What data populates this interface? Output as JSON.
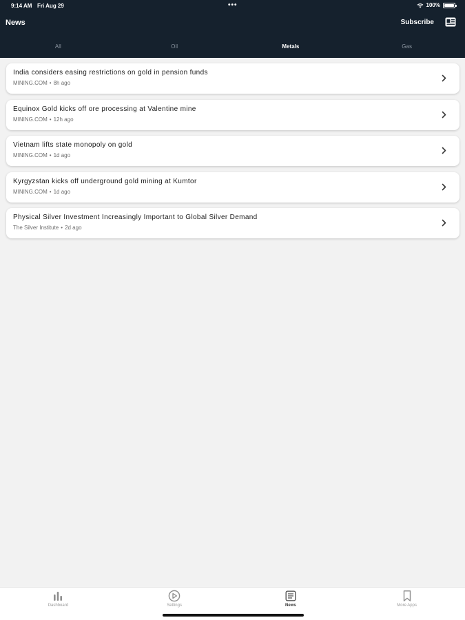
{
  "status_bar": {
    "time": "9:14 AM",
    "date": "Fri Aug 29",
    "dots": "•••",
    "battery": "100%"
  },
  "nav": {
    "title": "News",
    "subscribe_label": "Subscribe",
    "reader_icon": "reader-mode-icon"
  },
  "tabs": [
    {
      "label": "All",
      "active": false
    },
    {
      "label": "Oil",
      "active": false
    },
    {
      "label": "Metals",
      "active": true
    },
    {
      "label": "Gas",
      "active": false
    }
  ],
  "news": [
    {
      "title": "India considers easing restrictions on gold in pension funds",
      "source": "MINING.COM",
      "age": "8h ago"
    },
    {
      "title": "Equinox Gold kicks off ore processing at Valentine mine",
      "source": "MINING.COM",
      "age": "12h ago"
    },
    {
      "title": "Vietnam lifts state monopoly on gold",
      "source": "MINING.COM",
      "age": "1d ago"
    },
    {
      "title": "Kyrgyzstan kicks off underground gold mining at Kumtor",
      "source": "MINING.COM",
      "age": "1d ago"
    },
    {
      "title": "Physical Silver Investment Increasingly Important to Global Silver Demand",
      "source": "The Silver Institute",
      "age": "2d ago"
    }
  ],
  "meta_separator": "•",
  "tabbar": [
    {
      "label": "Dashboard",
      "icon": "bar-chart-icon",
      "active": false
    },
    {
      "label": "Settings",
      "icon": "play-circle-icon",
      "active": false
    },
    {
      "label": "News",
      "icon": "newspaper-icon",
      "active": true
    },
    {
      "label": "More Apps",
      "icon": "bookmark-icon",
      "active": false
    }
  ],
  "colors": {
    "header_bg": "#15212d",
    "page_bg": "#f2f2f2",
    "card_bg": "#ffffff",
    "tab_inactive": "#8b95a0",
    "tab_active": "#ffffff"
  }
}
